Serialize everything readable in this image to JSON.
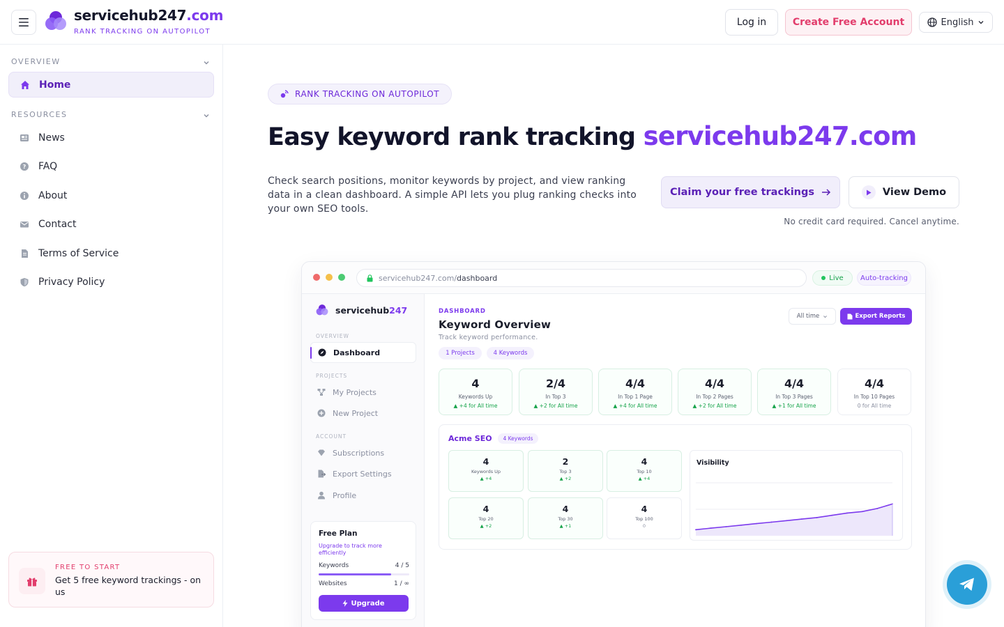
{
  "header": {
    "brand_name": "servicehub247",
    "brand_tld": ".com",
    "tagline": "RANK TRACKING ON AUTOPILOT",
    "login_label": "Log in",
    "signup_label": "Create Free Account",
    "language": "English"
  },
  "sidebar": {
    "overview_label": "OVERVIEW",
    "resources_label": "RESOURCES",
    "items": [
      {
        "label": "Home",
        "icon": "home-icon"
      },
      {
        "label": "News",
        "icon": "newspaper-icon"
      },
      {
        "label": "FAQ",
        "icon": "question-icon"
      },
      {
        "label": "About",
        "icon": "info-icon"
      },
      {
        "label": "Contact",
        "icon": "mail-icon"
      },
      {
        "label": "Terms of Service",
        "icon": "document-icon"
      },
      {
        "label": "Privacy Policy",
        "icon": "shield-icon"
      }
    ],
    "promo": {
      "label": "FREE TO START",
      "text": "Get 5 free keyword trackings - on us"
    }
  },
  "hero": {
    "badge": "RANK TRACKING ON AUTOPILOT",
    "headline": "Easy keyword rank tracking",
    "headline_accent": "servicehub247.com",
    "description": "Check search positions, monitor keywords by project, and view ranking data in a clean dashboard. A simple API lets you plug ranking checks into your own SEO tools.",
    "claim_label": "Claim your free trackings",
    "demo_label": "View Demo",
    "note": "No credit card required. Cancel anytime."
  },
  "mock": {
    "url_host": "servicehub247.com/",
    "url_path": "dashboard",
    "live_label": "Live",
    "auto_label": "Auto-tracking",
    "brand_name": "servicehub",
    "brand_num": "247",
    "nav": {
      "overview_label": "OVERVIEW",
      "projects_label": "PROJECTS",
      "account_label": "ACCOUNT",
      "dashboard": "Dashboard",
      "my_projects": "My Projects",
      "new_project": "New Project",
      "subscriptions": "Subscriptions",
      "export_settings": "Export Settings",
      "profile": "Profile"
    },
    "plan": {
      "title": "Free Plan",
      "subtitle": "Upgrade to track more efficiently",
      "keywords_label": "Keywords",
      "keywords_value": "4 / 5",
      "keywords_fraction": 0.8,
      "websites_label": "Websites",
      "websites_value": "1 / ∞",
      "upgrade_label": "Upgrade"
    },
    "dashboard": {
      "label": "DASHBOARD",
      "title": "Keyword Overview",
      "subtitle": "Track keyword performance.",
      "chip_projects": "1 Projects",
      "chip_keywords": "4 Keywords",
      "time_filter": "All time",
      "export_label": "Export Reports",
      "stats": [
        {
          "value": "4",
          "label": "Keywords Up",
          "delta": "▲ +4 for All time"
        },
        {
          "value": "2/4",
          "label": "In Top 3",
          "delta": "▲ +2 for All time"
        },
        {
          "value": "4/4",
          "label": "In Top 1 Page",
          "delta": "▲ +4 for All time"
        },
        {
          "value": "4/4",
          "label": "In Top 2 Pages",
          "delta": "▲ +2 for All time"
        },
        {
          "value": "4/4",
          "label": "In Top 3 Pages",
          "delta": "▲ +1 for All time"
        },
        {
          "value": "4/4",
          "label": "In Top 10 Pages",
          "delta": "0 for All time"
        }
      ]
    },
    "project": {
      "name": "Acme SEO",
      "chip": "4 Keywords",
      "stats": [
        {
          "value": "4",
          "label": "Keywords Up",
          "delta": "▲ +4"
        },
        {
          "value": "2",
          "label": "Top 3",
          "delta": "▲ +2"
        },
        {
          "value": "4",
          "label": "Top 10",
          "delta": "▲ +4"
        },
        {
          "value": "4",
          "label": "Top 20",
          "delta": "▲ +2"
        },
        {
          "value": "4",
          "label": "Top 30",
          "delta": "▲ +1"
        },
        {
          "value": "4",
          "label": "Top 100",
          "delta": "0"
        }
      ],
      "visibility_title": "Visibility"
    }
  },
  "chart_data": {
    "type": "area",
    "title": "Visibility",
    "x": [
      1,
      2,
      3,
      4,
      5,
      6,
      7,
      8,
      9,
      10,
      11,
      12,
      13,
      14
    ],
    "values": [
      8,
      10,
      12,
      14,
      16,
      18,
      20,
      22,
      24,
      27,
      30,
      32,
      36,
      42
    ],
    "xlabel": "",
    "ylabel": "",
    "ylim": [
      0,
      70
    ],
    "grid": true
  },
  "colors": {
    "accent": "#7c3aed",
    "pink": "#e23d6c",
    "green": "#16a34a",
    "telegram": "#2a9fd8"
  }
}
